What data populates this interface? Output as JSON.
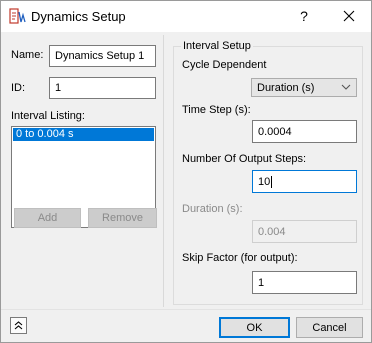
{
  "window": {
    "title": "Dynamics Setup",
    "help_label": "?"
  },
  "left": {
    "name_label": "Name:",
    "name_value": "Dynamics Setup 1",
    "id_label": "ID:",
    "id_value": "1",
    "interval_listing_label": "Interval Listing:",
    "interval_items": [
      "0 to 0.004 s"
    ],
    "add_label": "Add",
    "remove_label": "Remove"
  },
  "interval_setup": {
    "group_title": "Interval Setup",
    "cycle_dependent_label": "Cycle Dependent",
    "cycle_dependent_selected": "Duration (s)",
    "time_step_label": "Time Step (s):",
    "time_step_value": "0.0004",
    "num_output_steps_label": "Number Of Output Steps:",
    "num_output_steps_value": "10",
    "duration_label": "Duration (s):",
    "duration_value": "0.004",
    "skip_factor_label": "Skip Factor (for output):",
    "skip_factor_value": "1"
  },
  "footer": {
    "ok_label": "OK",
    "cancel_label": "Cancel"
  },
  "icons": {
    "app": "dynamics-app-icon",
    "close": "close-icon",
    "dropdown": "chevron-down-icon",
    "collapse": "double-chevron-up-icon"
  },
  "colors": {
    "accent": "#0078d7",
    "dialog_bg": "#f0f0f0",
    "selection": "#0078d7",
    "app_icon_red": "#c0392b"
  }
}
